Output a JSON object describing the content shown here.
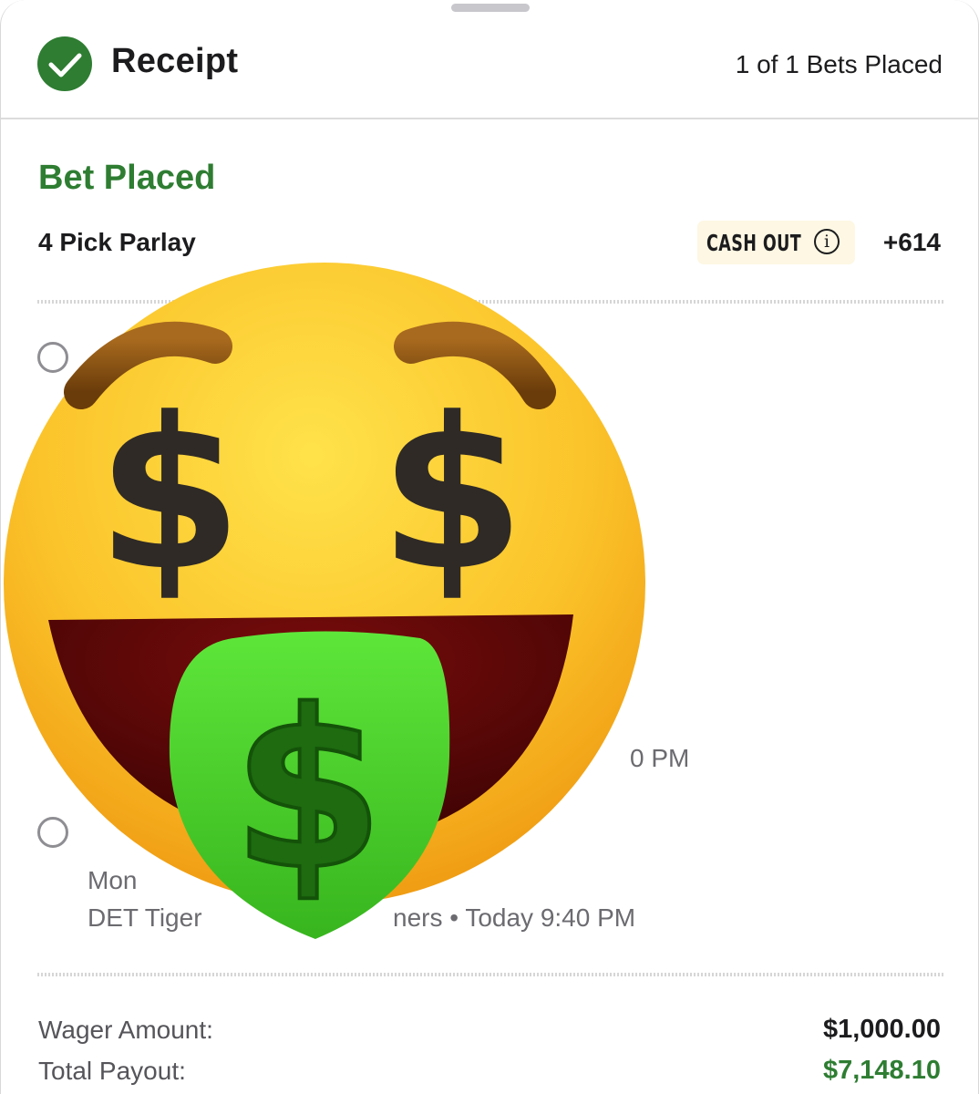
{
  "header": {
    "title": "Receipt",
    "bets_count": "1 of 1 Bets Placed"
  },
  "bet": {
    "status": "Bet Placed",
    "type": "4 Pick Parlay",
    "cash_out_label": "CASH OUT",
    "odds": "+614",
    "legs_visible_text": {
      "leg3_time_fragment": "0 PM",
      "leg4_line1_fragment": "Mon",
      "leg4_line2_left": "DET Tiger",
      "leg4_line2_right": "ners • Today 9:40 PM"
    }
  },
  "summary": {
    "wager_label": "Wager Amount:",
    "wager_value": "$1,000.00",
    "payout_label": "Total Payout:",
    "payout_value": "$7,148.10"
  },
  "colors": {
    "accent_green": "#2e7d32",
    "cashout_bg": "#fdf7e3"
  },
  "overlay": {
    "icon": "money-mouth-face-emoji"
  }
}
